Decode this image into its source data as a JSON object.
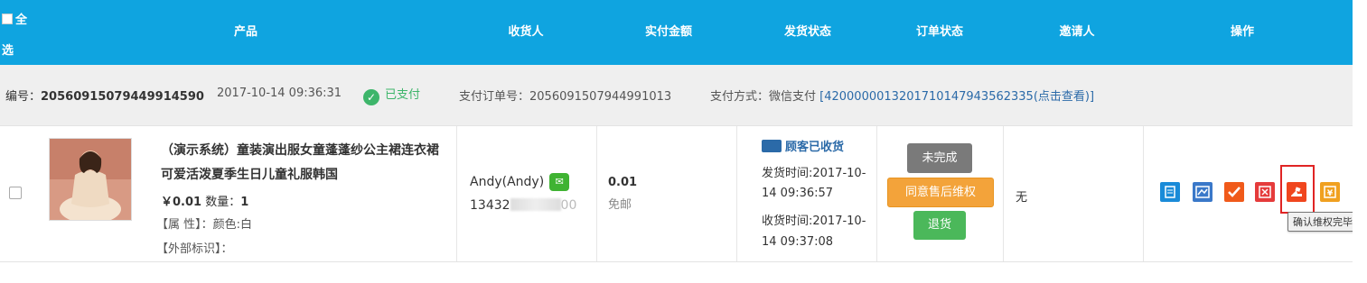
{
  "header": {
    "select_all": "全选",
    "columns": [
      "产品",
      "收货人",
      "实付金额",
      "发货状态",
      "订单状态",
      "邀请人",
      "操作"
    ]
  },
  "order": {
    "number_label": "编号：",
    "number": "20560915079449914590",
    "datetime": "2017-10-14 09:36:31",
    "paid_status": "已支付",
    "payment_order_label": "支付订单号：",
    "payment_order": "2056091507944991013",
    "payment_method_label": "支付方式：微信支付",
    "transaction_link": "[4200000013201710147943562335(点击查看)]"
  },
  "item": {
    "title": "（演示系统）童装演出服女童蓬蓬纱公主裙连衣裙可爱活泼夏季生日儿童礼服韩国",
    "price": "￥0.01",
    "qty_label": "数量：",
    "qty": "1",
    "attr_label": "【属 性】：颜色:白",
    "ext_label": "【外部标识】："
  },
  "buyer": {
    "name": "Andy(Andy)",
    "phone_visible": "13432",
    "phone_tail": "00"
  },
  "payment": {
    "amount": "0.01",
    "shipping": "免邮"
  },
  "shipping": {
    "status": "顾客已收货",
    "ship_time_label": "发货时间:2017-10-",
    "ship_time_tail": "14 09:36:57",
    "recv_time_label": "收货时间:2017-10-",
    "recv_time_tail": "14 09:37:08"
  },
  "order_status": {
    "incomplete": "未完成",
    "agree_rights": "同意售后维权",
    "return": "退货"
  },
  "inviter": "无",
  "actions": {
    "icons": [
      "edit-icon",
      "signature-icon",
      "check-icon",
      "cancel-icon",
      "confirm-rights-icon",
      "refund-icon"
    ],
    "colors": [
      "#1a8bd8",
      "#3a78c9",
      "#f05a1a",
      "#e53b3b",
      "#f0461e",
      "#f0a020"
    ],
    "tooltip": "确认维权完毕"
  }
}
